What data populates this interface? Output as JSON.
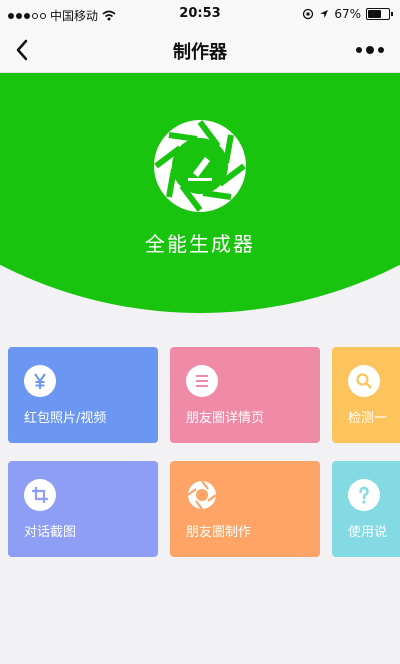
{
  "status_bar": {
    "carrier": "中国移动",
    "time": "20:53",
    "battery": "67%",
    "battery_level": 0.67
  },
  "nav": {
    "title": "制作器"
  },
  "hero": {
    "app_name": "全能生成器"
  },
  "tiles": [
    {
      "label": "红包照片/视频",
      "icon": "yen-icon",
      "color": "#6b97f3"
    },
    {
      "label": "朋友圈详情页",
      "icon": "list-icon",
      "color": "#ef8aa7"
    },
    {
      "label": "检测一",
      "icon": "search-icon",
      "color": "#fdc35c"
    },
    {
      "label": "对话截图",
      "icon": "crop-icon",
      "color": "#8d9ef4"
    },
    {
      "label": "朋友圈制作",
      "icon": "aperture-icon",
      "color": "#fda466"
    },
    {
      "label": "使用说",
      "icon": "question-icon",
      "color": "#83dae3"
    }
  ]
}
